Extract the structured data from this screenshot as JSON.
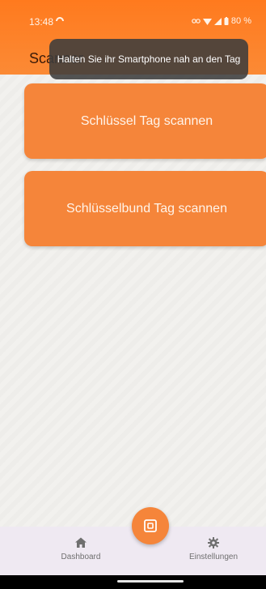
{
  "status_bar": {
    "time": "13:48",
    "battery": "80 %"
  },
  "header": {
    "title": "Scanner"
  },
  "toast": {
    "message": "Halten Sie ihr Smartphone nah an den Tag"
  },
  "buttons": {
    "scan_key": "Schlüssel Tag scannen",
    "scan_keyring": "Schlüsselbund Tag scannen"
  },
  "bottom_nav": {
    "items": [
      {
        "label": "Dashboard",
        "icon": "home-icon"
      },
      {
        "label": "Einstellungen",
        "icon": "gear-icon"
      }
    ],
    "fab_icon": "nfc-icon"
  },
  "colors": {
    "accent": "#f5853a",
    "header": "#ff7a1e",
    "toast_bg": "#3c3c3c",
    "nav_bg": "#efe9f2"
  }
}
